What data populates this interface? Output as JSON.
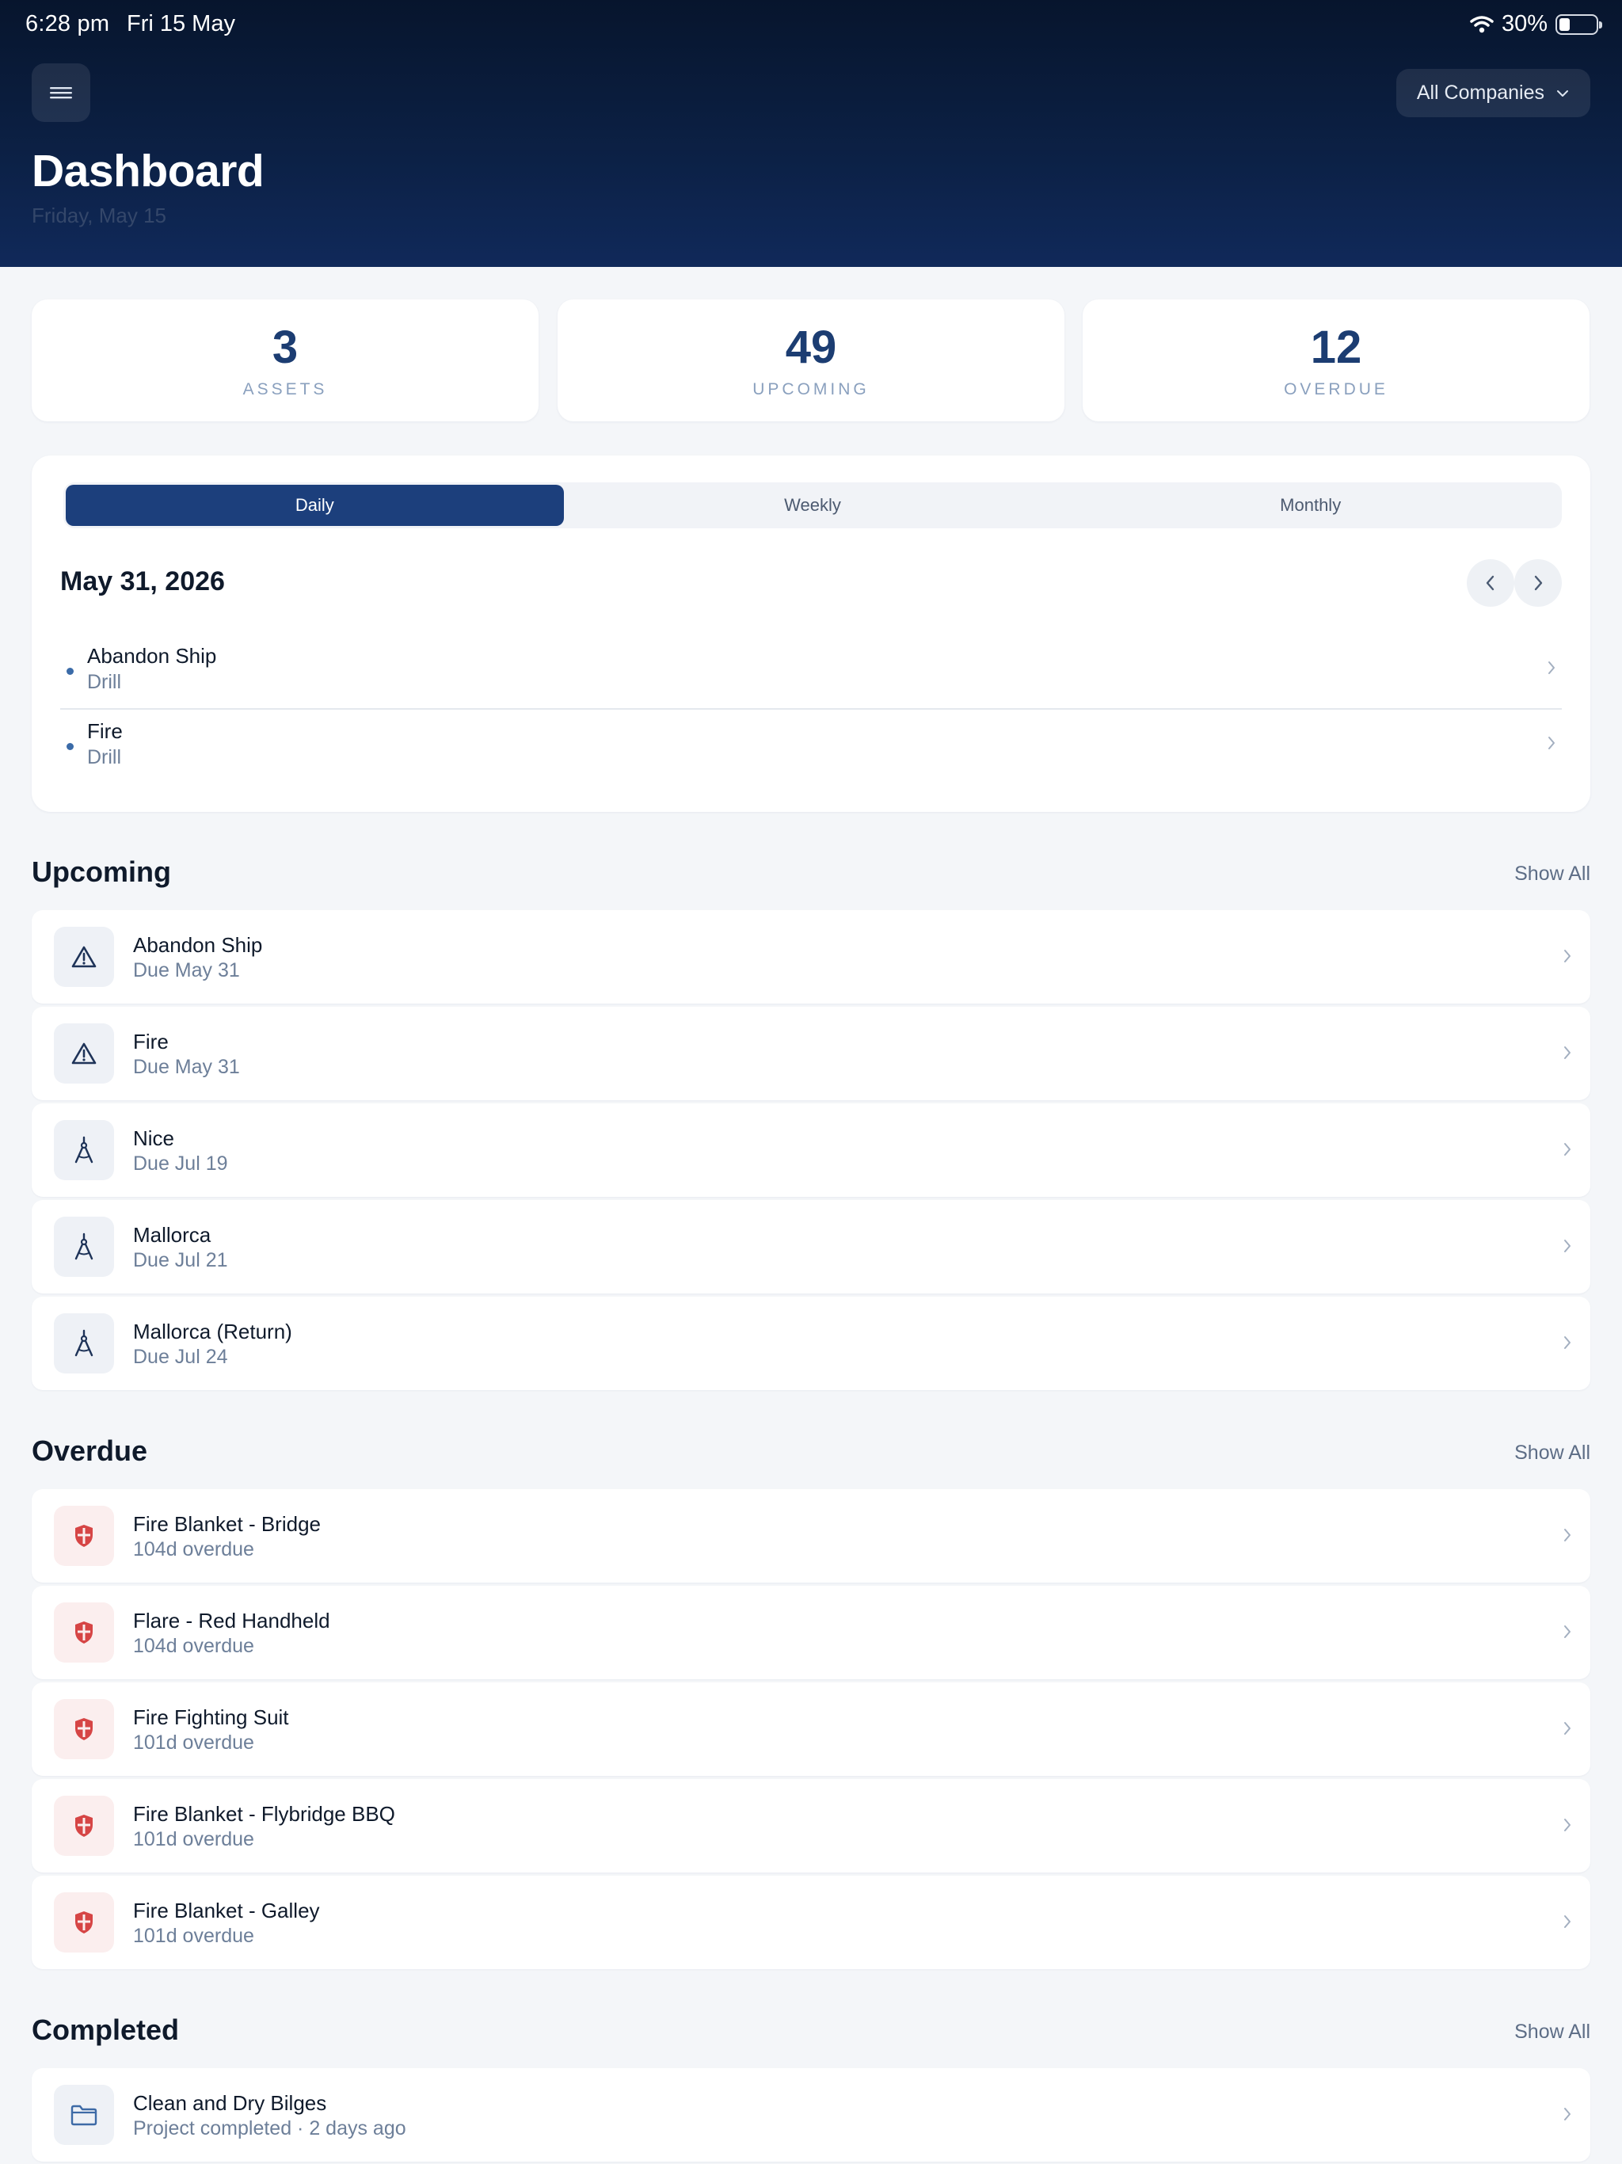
{
  "status_bar": {
    "time": "6:28 pm",
    "date": "Fri 15 May",
    "battery_percent": "30%",
    "battery_level": 0.3
  },
  "header": {
    "company_selector": "All Companies",
    "title": "Dashboard",
    "subtitle": "Friday, May 15"
  },
  "stats": [
    {
      "value": "3",
      "label": "ASSETS"
    },
    {
      "value": "49",
      "label": "UPCOMING"
    },
    {
      "value": "12",
      "label": "OVERDUE"
    }
  ],
  "calendar": {
    "tabs": [
      "Daily",
      "Weekly",
      "Monthly"
    ],
    "active_tab": "Daily",
    "date": "May 31, 2026",
    "items": [
      {
        "title": "Abandon Ship",
        "subtitle": "Drill"
      },
      {
        "title": "Fire",
        "subtitle": "Drill"
      }
    ]
  },
  "upcoming": {
    "title": "Upcoming",
    "show_all": "Show All",
    "items": [
      {
        "title": "Abandon Ship",
        "subtitle": "Due May 31",
        "icon": "warning-triangle-icon"
      },
      {
        "title": "Fire",
        "subtitle": "Due May 31",
        "icon": "warning-triangle-icon"
      },
      {
        "title": "Nice",
        "subtitle": "Due Jul 19",
        "icon": "compass-icon"
      },
      {
        "title": "Mallorca",
        "subtitle": "Due Jul 21",
        "icon": "compass-icon"
      },
      {
        "title": "Mallorca (Return)",
        "subtitle": "Due Jul 24",
        "icon": "compass-icon"
      }
    ]
  },
  "overdue": {
    "title": "Overdue",
    "show_all": "Show All",
    "items": [
      {
        "title": "Fire Blanket - Bridge",
        "subtitle": "104d overdue",
        "icon": "shield-icon"
      },
      {
        "title": "Flare - Red Handheld",
        "subtitle": "104d overdue",
        "icon": "shield-icon"
      },
      {
        "title": "Fire Fighting Suit",
        "subtitle": "101d overdue",
        "icon": "shield-icon"
      },
      {
        "title": "Fire Blanket - Flybridge BBQ",
        "subtitle": "101d overdue",
        "icon": "shield-icon"
      },
      {
        "title": "Fire Blanket - Galley",
        "subtitle": "101d overdue",
        "icon": "shield-icon"
      }
    ]
  },
  "completed": {
    "title": "Completed",
    "show_all": "Show All",
    "items": [
      {
        "title": "Clean and Dry Bilges",
        "subtitle": "Project completed · 2 days ago",
        "icon": "folder-icon"
      }
    ]
  },
  "colors": {
    "header_bg": "#0c2146",
    "accent": "#1c3f7c",
    "overdue_red": "#d64545"
  }
}
